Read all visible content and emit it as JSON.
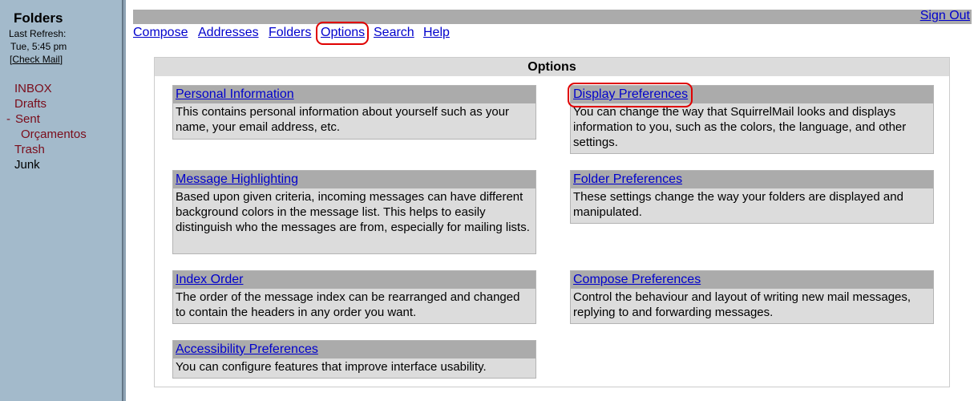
{
  "sidebar": {
    "title": "Folders",
    "last_refresh_label": "Last Refresh:",
    "last_refresh_time": "Tue, 5:45 pm",
    "check_mail_open": "[",
    "check_mail": "Check Mail",
    "check_mail_close": "]",
    "folders": [
      {
        "label": "INBOX"
      },
      {
        "label": "Drafts"
      },
      {
        "label": "Sent",
        "toggle": "-"
      },
      {
        "label": "Orçamentos"
      },
      {
        "label": "Trash"
      },
      {
        "label": "Junk"
      }
    ]
  },
  "header": {
    "sign_out": "Sign Out",
    "nav": [
      "Compose",
      "Addresses",
      "Folders",
      "Options",
      "Search",
      "Help"
    ]
  },
  "options": {
    "title": "Options",
    "cards": [
      {
        "title": "Personal Information",
        "description": "This contains personal information about yourself such as your name, your email address, etc."
      },
      {
        "title": "Display Preferences",
        "description": "You can change the way that SquirrelMail looks and displays information to you, such as the colors, the language, and other settings."
      },
      {
        "title": "Message Highlighting",
        "description": "Based upon given criteria, incoming messages can have different background colors in the message list. This helps to easily distinguish who the messages are from, especially for mailing lists."
      },
      {
        "title": "Folder Preferences",
        "description": "These settings change the way your folders are displayed and manipulated."
      },
      {
        "title": "Index Order",
        "description": "The order of the message index can be rearranged and changed to contain the headers in any order you want."
      },
      {
        "title": "Compose Preferences",
        "description": "Control the behaviour and layout of writing new mail messages, replying to and forwarding messages."
      },
      {
        "title": "Accessibility Preferences",
        "description": "You can configure features that improve interface usability."
      }
    ]
  },
  "colors": {
    "link": "#0000cc",
    "folder": "#7a0c1a",
    "sidebar_bg": "#a3bacb",
    "highlight_circle": "#e00000"
  }
}
